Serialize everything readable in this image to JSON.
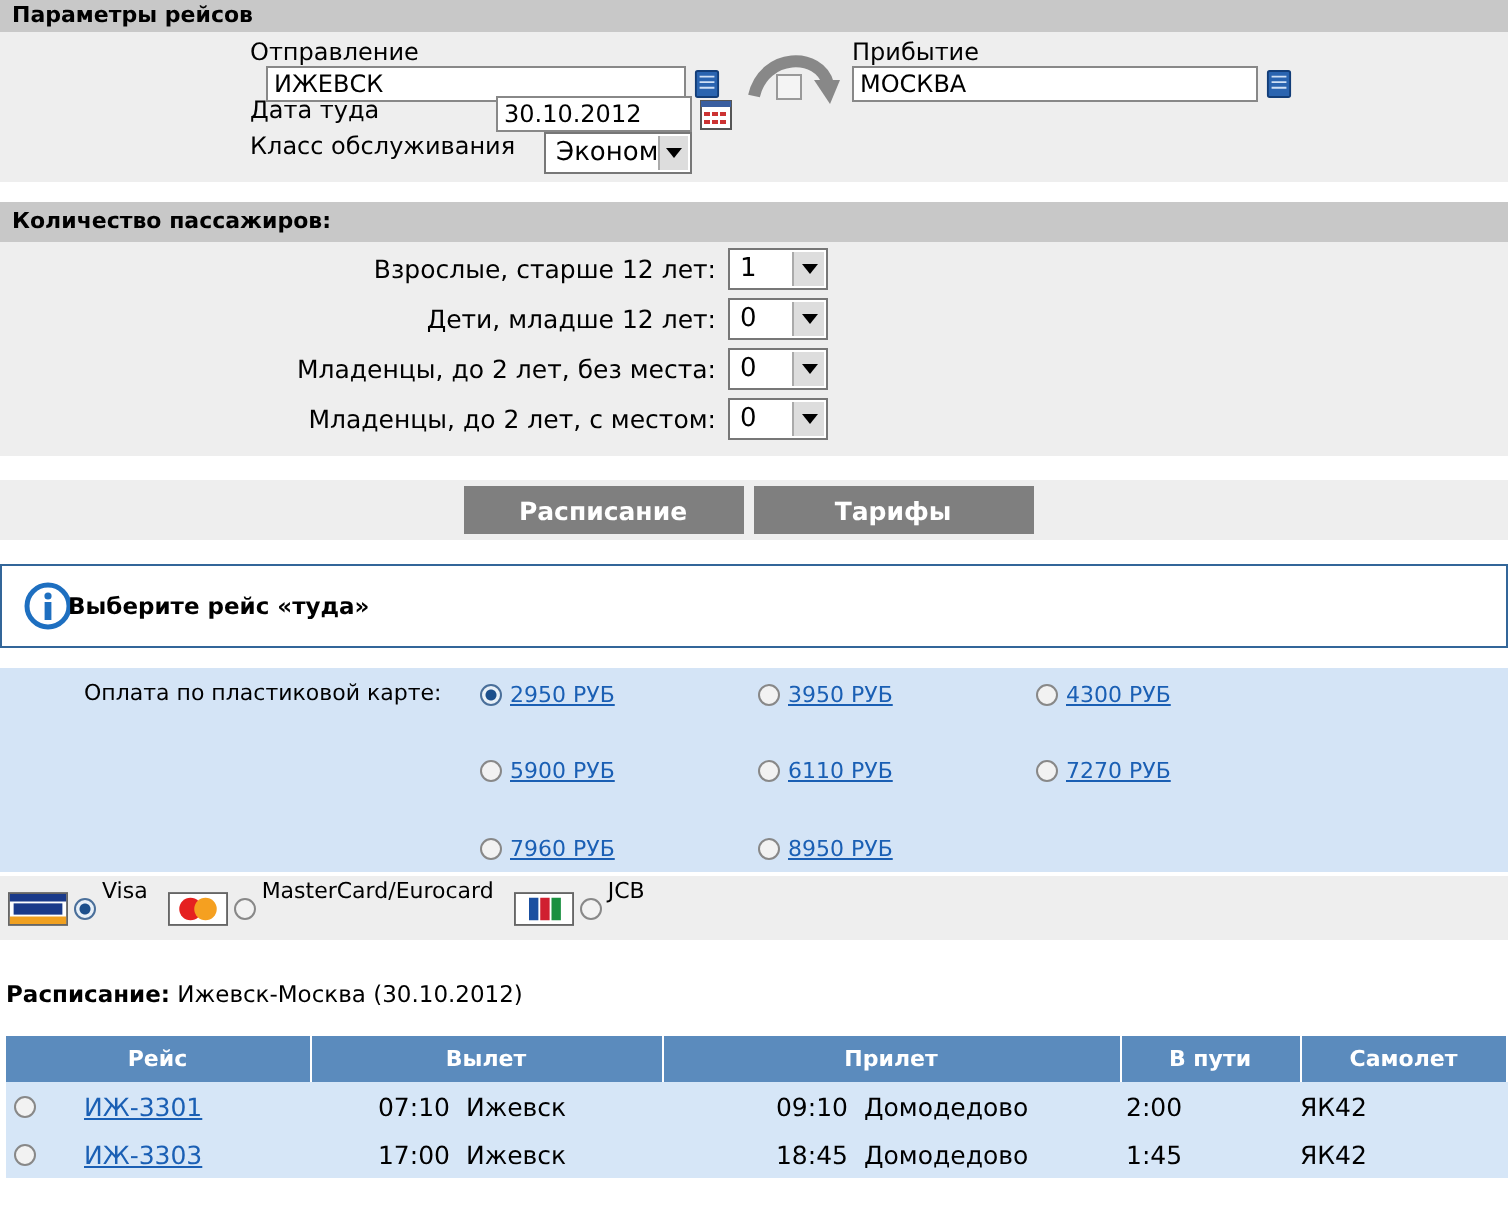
{
  "flight_params": {
    "title": "Параметры рейсов",
    "departure": {
      "label": "Отправление",
      "value": "ИЖЕВСК"
    },
    "swap": {
      "checked": false
    },
    "arrival": {
      "label": "Прибытие",
      "value": "МОСКВА"
    },
    "date": {
      "label": "Дата туда",
      "value": "30.10.2012"
    },
    "service_class": {
      "label": "Класс обслуживания",
      "value": "Эконом"
    }
  },
  "passengers": {
    "title": "Количество пассажиров:",
    "rows": [
      {
        "label": "Взрослые, старше 12 лет:",
        "value": "1"
      },
      {
        "label": "Дети, младше 12 лет:",
        "value": "0"
      },
      {
        "label": "Младенцы, до 2 лет, без места:",
        "value": "0"
      },
      {
        "label": "Младенцы, до 2 лет, с местом:",
        "value": "0"
      }
    ]
  },
  "buttons": [
    "Расписание",
    "Тарифы"
  ],
  "notice": "Выберите рейс «туда»",
  "payment": {
    "label": "Оплата по пластиковой карте:",
    "fares": [
      {
        "label": "2950 РУБ",
        "selected": true
      },
      {
        "label": "3950 РУБ",
        "selected": false
      },
      {
        "label": "4300 РУБ",
        "selected": false
      },
      {
        "label": "5900 РУБ",
        "selected": false
      },
      {
        "label": "6110 РУБ",
        "selected": false
      },
      {
        "label": "7270 РУБ",
        "selected": false
      },
      {
        "label": "7960 РУБ",
        "selected": false
      },
      {
        "label": "8950 РУБ",
        "selected": false
      }
    ]
  },
  "cards": [
    {
      "kind": "visa",
      "label": "Visa",
      "selected": true
    },
    {
      "kind": "mastercard",
      "label": "MasterCard/Eurocard",
      "selected": false
    },
    {
      "kind": "jcb",
      "label": "JCB",
      "selected": false
    }
  ],
  "schedule": {
    "title": "**Расписание:** Ижевск-Москва (30.10.2012)",
    "columns": [
      "Рейс",
      "Вылет",
      "Прилет",
      "В пути",
      "Самолет"
    ],
    "rows": [
      {
        "selected": false,
        "flight": "ИЖ-3301",
        "dep_time": "07:10",
        "dep_city": "Ижевск",
        "arr_time": "09:10",
        "arr_airport": "Домодедово",
        "duration": "2:00",
        "aircraft": "ЯК42"
      },
      {
        "selected": false,
        "flight": "ИЖ-3303",
        "dep_time": "17:00",
        "dep_city": "Ижевск",
        "arr_time": "18:45",
        "arr_airport": "Домодедово",
        "duration": "1:45",
        "aircraft": "ЯК42"
      }
    ]
  }
}
